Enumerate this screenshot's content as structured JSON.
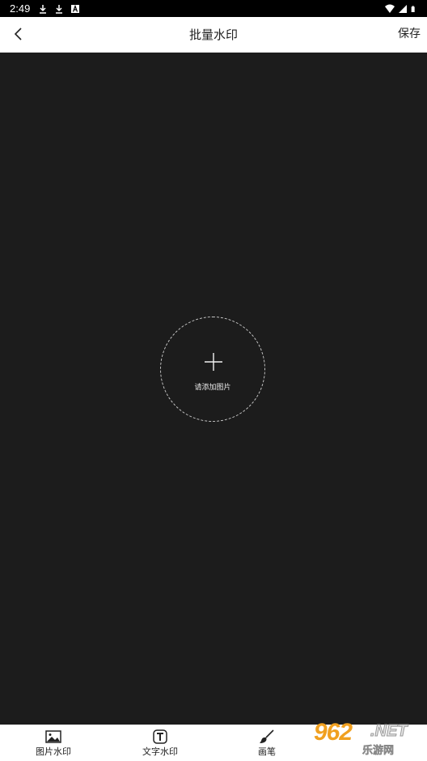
{
  "status_bar": {
    "time": "2:49",
    "left_icons": [
      "download-icon",
      "download-icon",
      "font-a-icon"
    ],
    "right_icons": [
      "wifi-icon",
      "cell-signal-icon",
      "battery-icon"
    ]
  },
  "app_bar": {
    "back_icon": "chevron-left-icon",
    "title": "批量水印",
    "save_label": "保存"
  },
  "canvas": {
    "background": "#1c1c1c",
    "add_icon": "plus-icon",
    "add_label": "请添加图片"
  },
  "bottom_bar": {
    "tools": [
      {
        "label": "图片水印",
        "icon": "image-icon"
      },
      {
        "label": "文字水印",
        "icon": "text-t-icon"
      },
      {
        "label": "画笔",
        "icon": "brush-icon"
      },
      {
        "label": "",
        "icon": ""
      }
    ]
  },
  "watermark": {
    "number": "962",
    "net": ".NET",
    "sub": "乐游网"
  }
}
